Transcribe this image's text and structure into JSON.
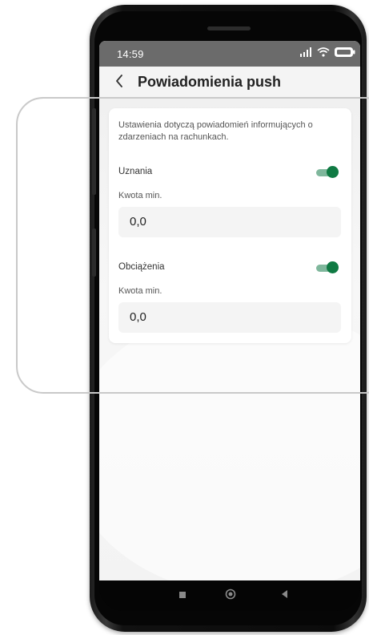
{
  "status_bar": {
    "time": "14:59",
    "icons": [
      "signal-icon",
      "wifi-icon",
      "battery-icon"
    ]
  },
  "header": {
    "back_icon": "chevron-left-icon",
    "title": "Powiadomienia push"
  },
  "settings": {
    "description": "Ustawienia dotyczą powiadomień informujących o zdarzeniach na rachunkach.",
    "credits": {
      "label": "Uznania",
      "enabled": true,
      "min_label": "Kwota min.",
      "min_value": "0,0"
    },
    "debits": {
      "label": "Obciążenia",
      "enabled": true,
      "min_label": "Kwota min.",
      "min_value": "0,0"
    }
  },
  "nav_bar": {
    "buttons": [
      "recent-apps-icon",
      "home-icon",
      "back-icon"
    ]
  },
  "colors": {
    "accent_green": "#0f7a43",
    "toggle_track": "#7fb79c",
    "status_bar": "#6b6b6b"
  }
}
